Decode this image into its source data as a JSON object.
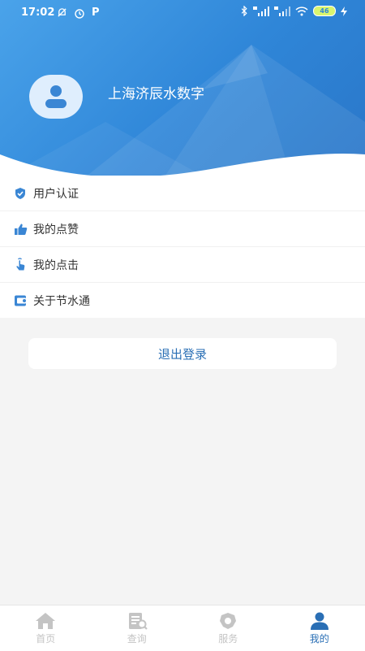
{
  "statusbar": {
    "time": "17:02",
    "battery": "46"
  },
  "profile": {
    "username": "上海济辰水数字"
  },
  "menu": {
    "items": [
      {
        "label": "用户认证",
        "icon": "shield-check-icon"
      },
      {
        "label": "我的点赞",
        "icon": "thumbs-up-icon"
      },
      {
        "label": "我的点击",
        "icon": "tap-hand-icon"
      },
      {
        "label": "关于节水通",
        "icon": "info-card-icon"
      }
    ]
  },
  "logout_label": "退出登录",
  "tabbar": {
    "tabs": [
      {
        "label": "首页",
        "icon": "home-icon",
        "active": false
      },
      {
        "label": "查询",
        "icon": "query-icon",
        "active": false
      },
      {
        "label": "服务",
        "icon": "service-icon",
        "active": false
      },
      {
        "label": "我的",
        "icon": "user-icon",
        "active": true
      }
    ]
  },
  "colors": {
    "header_start": "#4aa3ea",
    "header_end": "#2a76c8",
    "accent": "#2a6fb5",
    "icon_blue": "#3a86d4",
    "tab_inactive": "#c4c4c4"
  }
}
